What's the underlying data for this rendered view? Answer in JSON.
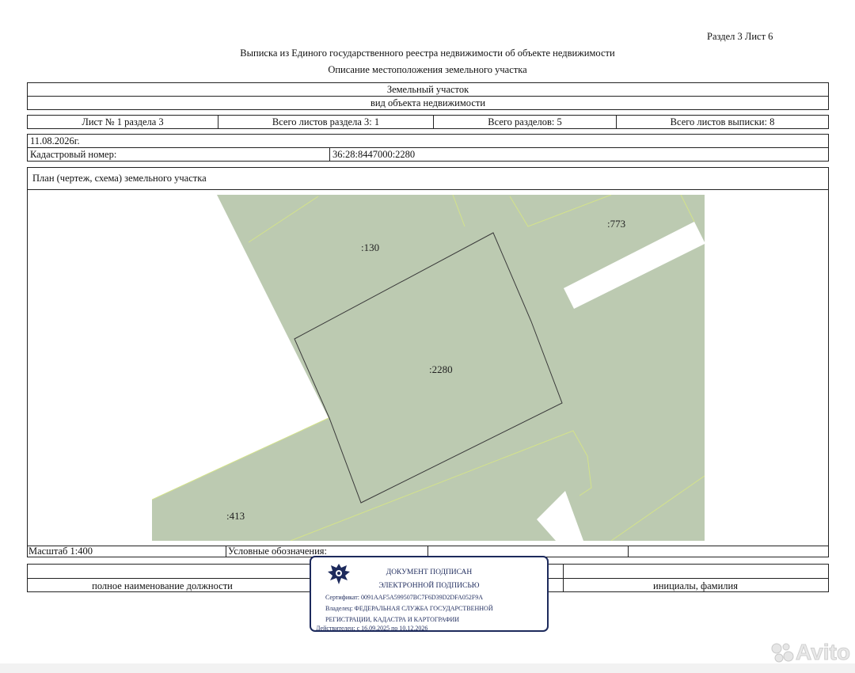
{
  "header": {
    "section_sheet": "Раздел 3    Лист 6",
    "title": "Выписка из Единого государственного реестра недвижимости об объекте недвижимости",
    "subtitle": "Описание местоположения земельного участка"
  },
  "object": {
    "type": "Земельный участок",
    "type_caption": "вид объекта недвижимости"
  },
  "sheets_row": {
    "sheet_of_section": "Лист № 1 раздела 3",
    "total_sheets_section": "Всего листов раздела 3: 1",
    "total_sections": "Всего разделов: 5",
    "total_sheets_extract": "Всего листов выписки: 8"
  },
  "date": "11.08.2026г.",
  "cadastral": {
    "label": "Кадастровый номер:",
    "value": "36:28:8447000:2280"
  },
  "plan": {
    "title": "План (чертеж, схема) земельного участка",
    "labels": {
      "parcel_130": ":130",
      "parcel_773": ":773",
      "parcel_2280": ":2280",
      "parcel_413": ":413"
    },
    "colors": {
      "parcel_fill": "#bccab1",
      "road_fill": "#ffffff",
      "outline": "#3a3a3a",
      "boundary": "#d4e38a"
    }
  },
  "scale_row": {
    "scale": "Масштаб 1:400",
    "legend": "Условные обозначения:"
  },
  "signature_row": {
    "position_caption": "полное наименование должности",
    "name_caption": "инициалы, фамилия"
  },
  "e_signature": {
    "line1": "ДОКУМЕНТ ПОДПИСАН",
    "line2": "ЭЛЕКТРОННОЙ ПОДПИСЬЮ",
    "certificate": "Сертификат: 0091AAF5A599507BC7F6D39D2DFA052F9A",
    "issued_to_1": "Владелец: ФЕДЕРАЛЬНАЯ СЛУЖБА ГОСУДАРСТВЕННОЙ",
    "issued_to_2": "РЕГИСТРАЦИИ, КАДАСТРА И КАРТОГРАФИИ",
    "valid": "Действителен: с 16.09.2025 по 10.12.2026",
    "emblem_icon": "eagle-emblem-icon"
  },
  "watermark": {
    "text": "Avito",
    "icon": "avito-logo-icon"
  }
}
